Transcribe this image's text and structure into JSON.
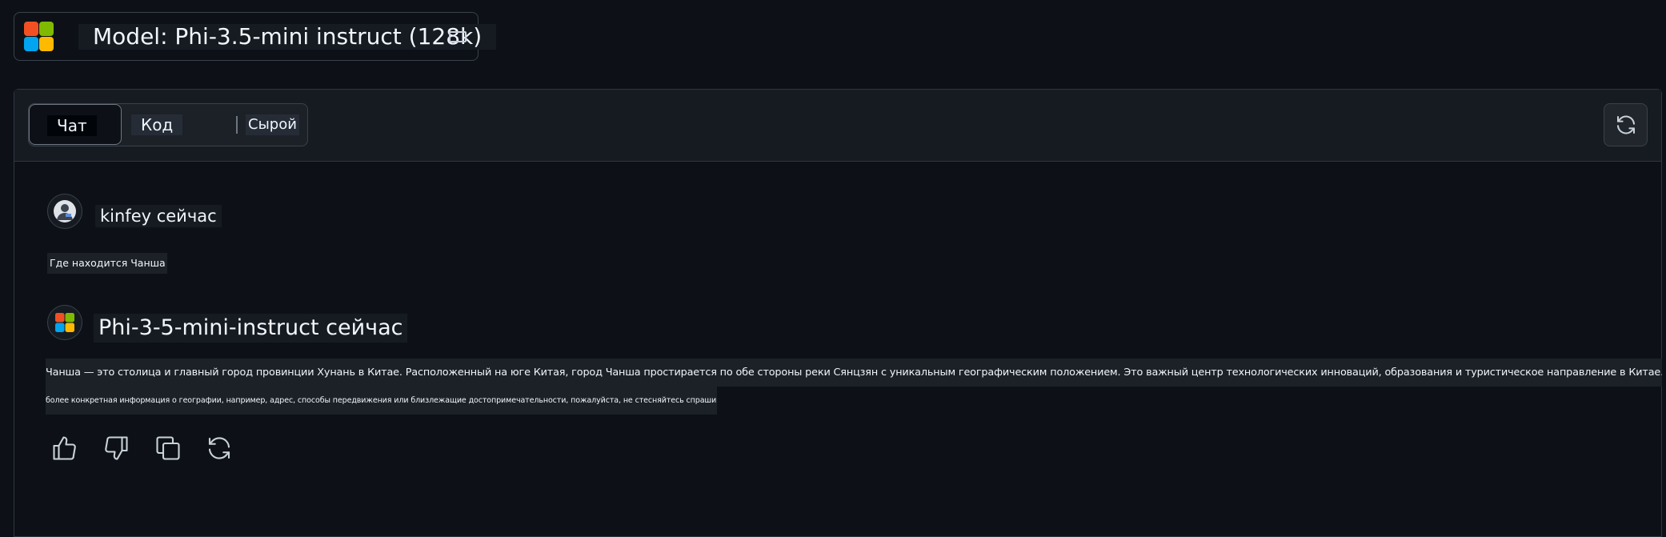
{
  "header": {
    "model_label": "Model: Phi-3.5-mini instruct (128k)",
    "logo_icon": "microsoft-logo-icon",
    "window_icon": "window-icon"
  },
  "tabs": [
    {
      "label": "Чат",
      "active": true
    },
    {
      "label": "Код",
      "active": false
    },
    {
      "label": "Сырой",
      "active": false
    }
  ],
  "refresh_icon": "refresh-icon",
  "messages": [
    {
      "sender": "kinfey сейчас",
      "text": "Где находится Чанша"
    },
    {
      "sender": "Phi-3-5-mini-instruct сейчас",
      "text_line1": "Чанша — это столица и главный город провинции Хунань в Китае. Расположенный на юге Китая, город Чанша простирается по обе стороны реки Сянцзян с уникальным географическим положением. Это важный центр технологических инноваций, образования и туристическое направление в Китае. Если вам нужна",
      "text_line2": "более конкретная информация о географии, например, адрес, способы передвижения или близлежащие достопримечательности, пожалуйста, не стесняйтесь спрашивать!"
    }
  ],
  "actions": [
    "thumbs-up-icon",
    "thumbs-down-icon",
    "copy-icon",
    "regenerate-icon"
  ],
  "colors": {
    "background": "#0d1117",
    "panel_header": "#161b22",
    "border": "#30363d",
    "text": "#f0f6fc",
    "ms_red": "#f25022",
    "ms_green": "#7fba00",
    "ms_blue": "#00a4ef",
    "ms_yellow": "#ffb900"
  }
}
